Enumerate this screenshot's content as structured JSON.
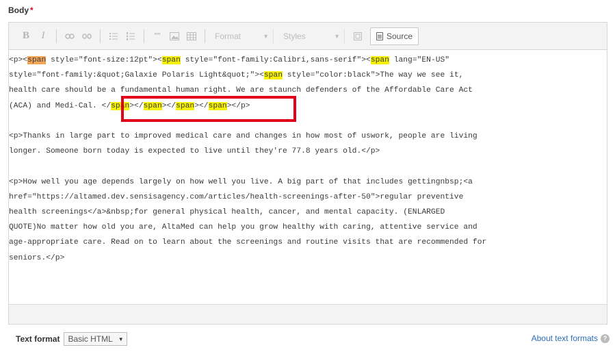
{
  "field": {
    "label": "Body",
    "required_marker": "*"
  },
  "toolbar": {
    "bold": "B",
    "italic": "I",
    "link_icon": "link-icon",
    "unlink_icon": "unlink-icon",
    "bullet_list_icon": "bulleted-list-icon",
    "numbered_list_icon": "numbered-list-icon",
    "blockquote": "””",
    "image_icon": "image-icon",
    "table_icon": "table-icon",
    "format_label": "Format",
    "styles_label": "Styles",
    "maximize_icon": "maximize-icon",
    "source_label": "Source"
  },
  "source_lines": [
    {
      "segments": [
        {
          "t": "<p><"
        },
        {
          "t": "span",
          "h": "orange"
        },
        {
          "t": " style=\"font-size:12pt\"><"
        },
        {
          "t": "span",
          "h": "yellow"
        },
        {
          "t": " style=\"font-family:Calibri,sans-serif\"><"
        },
        {
          "t": "span",
          "h": "yellow"
        },
        {
          "t": " lang=\"EN-US\""
        }
      ]
    },
    {
      "segments": [
        {
          "t": "style=\"font-family:&quot;Galaxie Polaris Light&quot;\"><"
        },
        {
          "t": "span",
          "h": "yellow"
        },
        {
          "t": " style=\"color:black\">The way we see it,"
        }
      ]
    },
    {
      "segments": [
        {
          "t": "health care should be a fundamental human right. We are staunch defenders of the Affordable Care Act"
        }
      ]
    },
    {
      "segments": [
        {
          "t": "(ACA) and Medi-Cal. </"
        },
        {
          "t": "span",
          "h": "yellow"
        },
        {
          "t": "></"
        },
        {
          "t": "span",
          "h": "yellow"
        },
        {
          "t": "></"
        },
        {
          "t": "span",
          "h": "yellow"
        },
        {
          "t": "></"
        },
        {
          "t": "span",
          "h": "yellow"
        },
        {
          "t": "></p>"
        }
      ]
    },
    {
      "segments": [
        {
          "t": ""
        }
      ]
    },
    {
      "segments": [
        {
          "t": "<p>Thanks in large part to improved medical care and changes in how most of uswork, people are living"
        }
      ]
    },
    {
      "segments": [
        {
          "t": "longer. Someone born today is expected to live until they're 77.8 years old.</p>"
        }
      ]
    },
    {
      "segments": [
        {
          "t": ""
        }
      ]
    },
    {
      "segments": [
        {
          "t": "<p>How well you age depends largely on how well you live. A big part of that includes gettingnbsp;<a"
        }
      ]
    },
    {
      "segments": [
        {
          "t": "href=\"https://altamed.dev.sensisagency.com/articles/health-screenings-after-50\">regular preventive"
        }
      ]
    },
    {
      "segments": [
        {
          "t": "health screenings</a>&nbsp;for general physical health, cancer, and mental capacity. (ENLARGED"
        }
      ]
    },
    {
      "segments": [
        {
          "t": "QUOTE)No matter how old you are, AltaMed can help you grow healthy with caring, attentive service and"
        }
      ]
    },
    {
      "segments": [
        {
          "t": "age-appropriate care. Read on to learn about the screenings and routine visits that are recommended for"
        }
      ]
    },
    {
      "segments": [
        {
          "t": "seniors.</p>"
        }
      ]
    }
  ],
  "footer": {
    "text_format_label": "Text format",
    "text_format_value": "Basic HTML",
    "about_link": "About text formats"
  }
}
